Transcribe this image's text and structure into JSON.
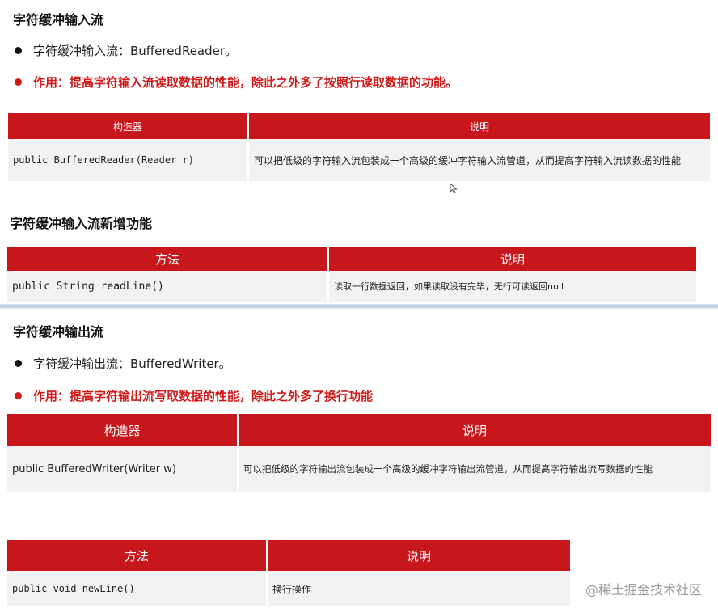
{
  "section1": {
    "title": "字符缓冲输入流",
    "bullet1": "字符缓冲输入流：BufferedReader。",
    "bullet2": "作用：提高字符输入流读取数据的性能，除此之外多了按照行读取数据的功能。",
    "table": {
      "headers": [
        "构造器",
        "说明"
      ],
      "row": [
        "public BufferedReader(Reader r)",
        "可以把低级的字符输入流包装成一个高级的缓冲字符输入流管道，从而提高字符输入流读数据的性能"
      ]
    }
  },
  "section2": {
    "title": "字符缓冲输入流新增功能",
    "table": {
      "headers": [
        "方法",
        "说明"
      ],
      "row": [
        "public String readLine()",
        "读取一行数据返回，如果读取没有完毕，无行可读返回null"
      ]
    }
  },
  "section3": {
    "title": "字符缓冲输出流",
    "bullet1": "字符缓冲输出流：BufferedWriter。",
    "bullet2": "作用：提高字符输出流写取数据的性能，除此之外多了换行功能",
    "table": {
      "headers": [
        "构造器",
        "说明"
      ],
      "row": [
        "public BufferedWriter(Writer w)",
        "可以把低级的字符输出流包装成一个高级的缓冲字符输出流管道，从而提高字符输出流写数据的性能"
      ]
    }
  },
  "section4": {
    "table": {
      "headers": [
        "方法",
        "说明"
      ],
      "row": [
        "public void newLine()",
        "换行操作"
      ]
    }
  },
  "watermark": "@稀土掘金技术社区",
  "colors": {
    "header_red": "#c8161d",
    "accent_red": "#d11a1a",
    "row_gray": "#f2f2f2"
  }
}
